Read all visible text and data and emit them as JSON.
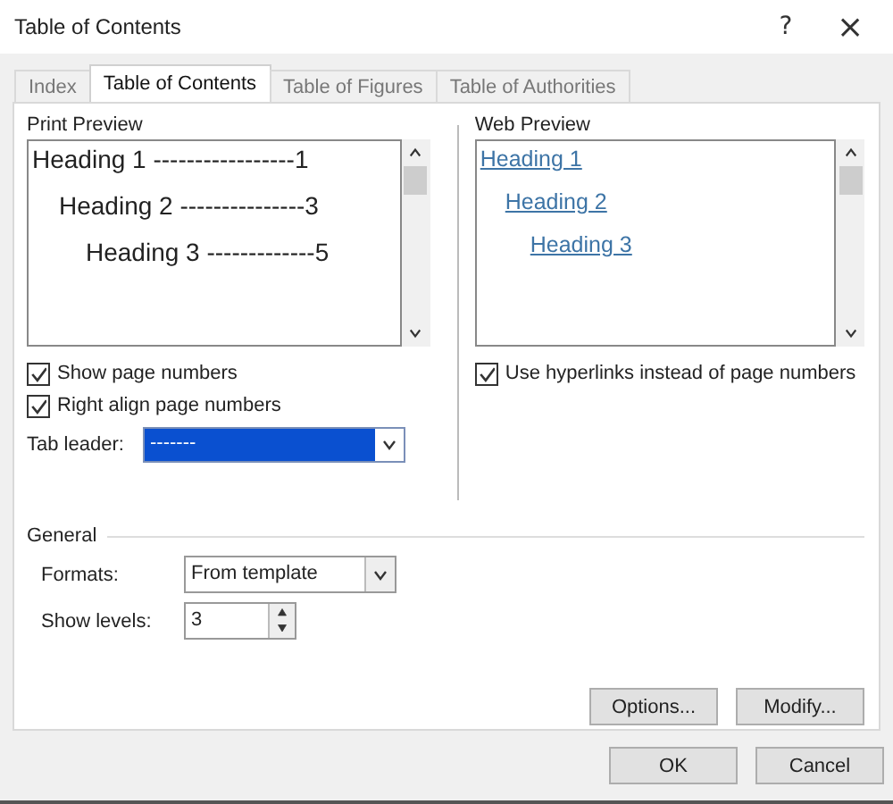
{
  "window": {
    "title": "Table of Contents",
    "help": "?",
    "close": "×"
  },
  "tabs": [
    {
      "label": "Index",
      "selected": false
    },
    {
      "label": "Table of Contents",
      "selected": true
    },
    {
      "label": "Table of Figures",
      "selected": false
    },
    {
      "label": "Table of Authorities",
      "selected": false
    }
  ],
  "print_preview": {
    "label": "Print Preview",
    "entries": [
      {
        "text": "Heading 1",
        "leader": "-----------------",
        "page": "1",
        "children": [
          {
            "text": "Heading 2",
            "leader": "---------------",
            "page": "3",
            "children": [
              {
                "text": "Heading 3",
                "leader": "-------------",
                "page": "5"
              }
            ]
          }
        ]
      }
    ],
    "options": [
      {
        "label": "Show page numbers",
        "checked": true
      },
      {
        "label": "Right align page numbers",
        "checked": true
      }
    ],
    "tab_leader": {
      "label": "Tab leader:",
      "value": "-------"
    }
  },
  "web_preview": {
    "label": "Web Preview",
    "entries": [
      {
        "text": "Heading 1",
        "children": [
          {
            "text": "Heading 2",
            "children": [
              {
                "text": "Heading 3"
              }
            ]
          }
        ]
      }
    ],
    "options": [
      {
        "label": "Use hyperlinks instead of page numbers",
        "checked": true
      }
    ]
  },
  "general": {
    "title": "General",
    "formats": {
      "label": "Formats:",
      "value": "From template"
    },
    "show_levels": {
      "label": "Show levels:",
      "value": "3"
    }
  },
  "panel_buttons": [
    "Options...",
    "Modify..."
  ],
  "buttons": [
    "OK",
    "Cancel"
  ]
}
